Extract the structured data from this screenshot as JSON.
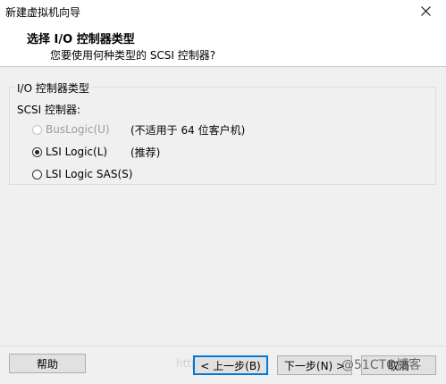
{
  "window": {
    "title": "新建虚拟机向导"
  },
  "header": {
    "title": "选择 I/O 控制器类型",
    "subtitle": "您要使用何种类型的 SCSI 控制器?"
  },
  "group": {
    "legend": "I/O 控制器类型",
    "scsi_label": "SCSI 控制器:",
    "options": [
      {
        "label": "BusLogic(U)",
        "note": "(不适用于 64 位客户机)",
        "selected": false,
        "enabled": false
      },
      {
        "label": "LSI Logic(L)",
        "note": "(推荐)",
        "selected": true,
        "enabled": true
      },
      {
        "label": "LSI Logic SAS(S)",
        "note": "",
        "selected": false,
        "enabled": true
      }
    ]
  },
  "footer": {
    "help": "帮助",
    "back": "< 上一步(B)",
    "next": "下一步(N) >",
    "cancel": "取消"
  },
  "watermark": {
    "url_text": "http://blog.",
    "brand": "@51CTO博客"
  },
  "colors": {
    "focus": "#0078d7",
    "dialog_bg": "#f0f0f0",
    "disabled_text": "#9c9c9c"
  }
}
